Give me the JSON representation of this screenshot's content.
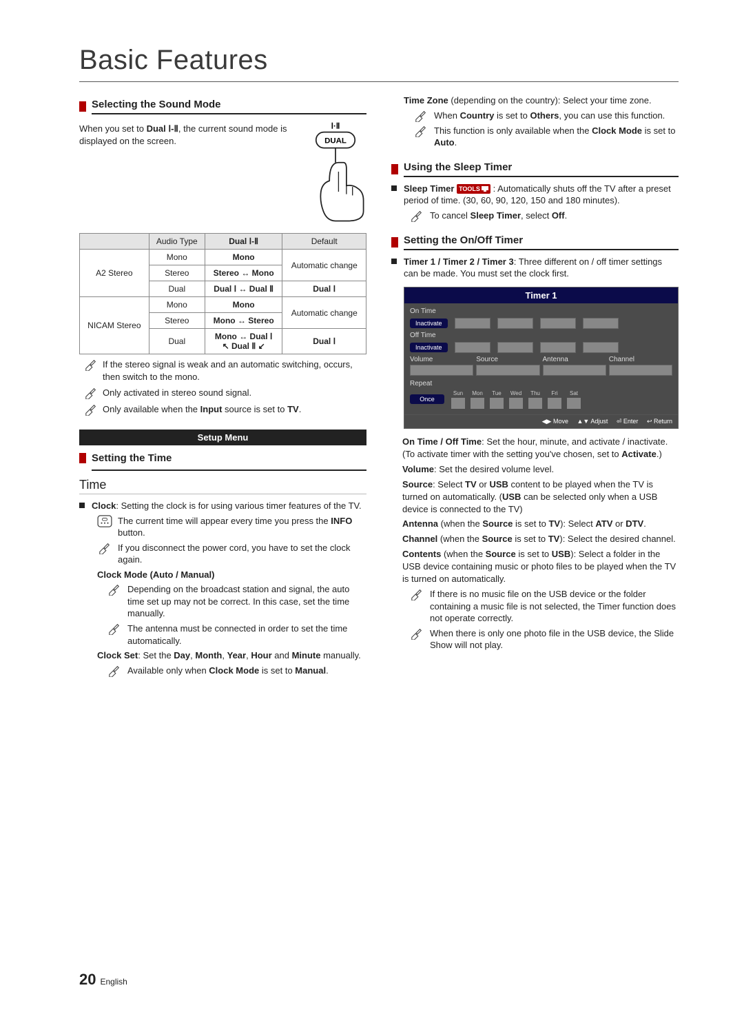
{
  "page": {
    "title": "Basic Features",
    "num": "20",
    "lang": "English"
  },
  "left": {
    "soundMode": {
      "heading": "Selecting the Sound Mode",
      "intro_pre": "When you set to ",
      "intro_bold": "Dual Ⅰ-Ⅱ",
      "intro_post": ", the current sound mode is displayed on the screen.",
      "dual_label_top": "Ⅰ·Ⅱ",
      "dual_btn": "DUAL"
    },
    "table": {
      "head": {
        "c0": "",
        "c1": "Audio Type",
        "c2": "Dual Ⅰ-Ⅱ",
        "c3": "Default"
      },
      "a2_label": "A2 Stereo",
      "a2": {
        "r0": {
          "at": "Mono",
          "d": "Mono",
          "def": "Automatic change"
        },
        "r1": {
          "at": "Stereo",
          "d": "Stereo ↔ Mono"
        },
        "r2": {
          "at": "Dual",
          "d": "Dual Ⅰ ↔ Dual Ⅱ",
          "def": "Dual Ⅰ"
        }
      },
      "nicam_label": "NICAM Stereo",
      "nicam": {
        "r0": {
          "at": "Mono",
          "d": "Mono",
          "def": "Automatic change"
        },
        "r1": {
          "at": "Stereo",
          "d": "Mono ↔ Stereo"
        },
        "r2": {
          "at": "Dual",
          "d1": "Mono ↔ Dual Ⅰ",
          "d2": "↖ Dual Ⅱ ↙",
          "def": "Dual Ⅰ"
        }
      }
    },
    "notes": {
      "n1": "If the stereo signal is weak and an automatic switching, occurs, then switch to the mono.",
      "n2": "Only activated in stereo sound signal.",
      "n3_pre": "Only available when the ",
      "n3_b": "Input",
      "n3_mid": " source is set to ",
      "n3_b2": "TV",
      "n3_post": "."
    },
    "setupMenu": "Setup Menu",
    "settingTime": "Setting the Time",
    "timeH2": "Time",
    "clock": {
      "label": "Clock",
      "text": ": Setting the clock is for using various timer features of the TV.",
      "info_pre": "The current time will appear every time you press the ",
      "info_b": "INFO",
      "info_post": " button.",
      "disc": "If you disconnect the power cord, you have to set the clock again.",
      "mode_head": "Clock Mode (Auto / Manual)",
      "mode_n1": "Depending on the broadcast station and signal, the auto time set up may not be correct. In this case, set the time manually.",
      "mode_n2": "The antenna must be connected in order to set the time automatically.",
      "set_pre": "Clock Set",
      "set_mid1": ": Set the ",
      "set_b1": "Day",
      "set_c": ", ",
      "set_b2": "Month",
      "set_b3": "Year",
      "set_b4": "Hour",
      "set_and": " and ",
      "set_b5": "Minute",
      "set_post": " manually.",
      "set_note_pre": "Available only when ",
      "set_note_b": "Clock Mode",
      "set_note_mid": " is set to ",
      "set_note_b2": "Manual",
      "set_note_post": "."
    }
  },
  "right": {
    "tz": {
      "line_b": "Time Zone",
      "line_post": " (depending on the country): Select your time zone.",
      "n1_pre": "When ",
      "n1_b": "Country",
      "n1_mid": " is set to ",
      "n1_b2": "Others",
      "n1_post": ", you can use this function.",
      "n2_pre": "This function is only available when the ",
      "n2_b": "Clock Mode",
      "n2_mid": " is set to ",
      "n2_b2": "Auto",
      "n2_post": "."
    },
    "sleep": {
      "heading": "Using the Sleep Timer",
      "label": "Sleep Timer",
      "tools": "TOOLS",
      "text": ": Automatically shuts off the TV after a preset period of time. (30, 60, 90, 120, 150 and 180 minutes).",
      "note_pre": "To cancel ",
      "note_b": "Sleep Timer",
      "note_mid": ", select ",
      "note_b2": "Off",
      "note_post": "."
    },
    "onoff": {
      "heading": "Setting the On/Off Timer",
      "bullet_b": "Timer 1 / Timer 2 / Timer 3",
      "bullet_post": ": Three different on / off timer settings can be made. You must set the clock first."
    },
    "osd": {
      "title": "Timer 1",
      "onTime": "On Time",
      "offTime": "Off Time",
      "inactivate": "Inactivate",
      "volume": "Volume",
      "source": "Source",
      "antenna": "Antenna",
      "channel": "Channel",
      "repeat": "Repeat",
      "once": "Once",
      "days": {
        "sun": "Sun",
        "mon": "Mon",
        "tue": "Tue",
        "wed": "Wed",
        "thu": "Thu",
        "fri": "Fri",
        "sat": "Sat"
      },
      "foot": {
        "move": "◀▶ Move",
        "adjust": "▲▼ Adjust",
        "enter": "⏎ Enter",
        "ret": "↩ Return"
      }
    },
    "after": {
      "p1_b": "On Time / Off Time",
      "p1_mid": ": Set the hour, minute, and activate / inactivate. (To activate timer with the setting you've chosen, set to ",
      "p1_b2": "Activate",
      "p1_post": ".)",
      "p2_b": "Volume",
      "p2_post": ": Set the desired volume level.",
      "p3_b": "Source",
      "p3_mid": ": Select ",
      "p3_b2": "TV",
      "p3_or": " or ",
      "p3_b3": "USB",
      "p3_post": " content to be played when the TV is turned on automatically. (",
      "p3_b4": "USB",
      "p3_post2": " can be selected only when a USB device is connected to the TV)",
      "p4_b": "Antenna",
      "p4_mid": " (when the ",
      "p4_b2": "Source",
      "p4_mid2": " is set to ",
      "p4_b3": "TV",
      "p4_mid3": "): Select ",
      "p4_b4": "ATV",
      "p4_or": " or ",
      "p4_b5": "DTV",
      "p4_post": ".",
      "p5_b": "Channel",
      "p5_mid": " (when the ",
      "p5_b2": "Source",
      "p5_mid2": " is set to ",
      "p5_b3": "TV",
      "p5_post": "): Select the desired channel.",
      "p6_b": "Contents",
      "p6_mid": " (when the ",
      "p6_b2": "Source",
      "p6_mid2": " is set to ",
      "p6_b3": "USB",
      "p6_post": "): Select a folder in the USB device containing music or photo files to be played when the TV is turned on automatically.",
      "n1": "If there is no music file on the USB device or the folder containing a music file is not selected, the Timer function does not operate correctly.",
      "n2": "When there is only one photo file in the USB device, the Slide Show will not play."
    }
  }
}
